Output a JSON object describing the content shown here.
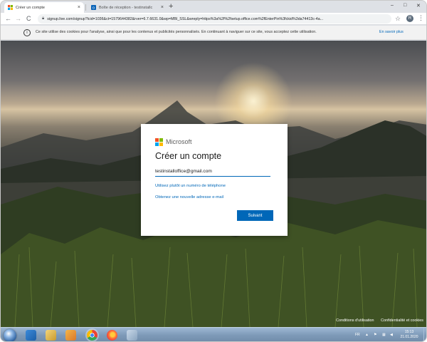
{
  "browser": {
    "tabs": [
      {
        "label": "Créer un compte",
        "active": true
      },
      {
        "label": "Boîte de réception - testinstallc",
        "active": false
      }
    ],
    "new_tab": "+",
    "nav": {
      "back": "←",
      "forward": "→",
      "reload": "C"
    },
    "url": "signup.live.com/signup?lcid=1036&ct=1579644382&rver=6.7.6631.0&wp=MBI_SSL&wreply=https%3a%2f%2fsetup.office.com%2fEnterPin%3fckid%3da74413c-4a...",
    "profile_initial": "R",
    "window_controls": {
      "minimize": "–",
      "maximize": "□",
      "close": "✕"
    }
  },
  "cookie_banner": {
    "info_glyph": "i",
    "text": "Ce site utilise des cookies pour l'analyse, ainsi que pour les contenus et publicités personnalisés. En continuant à naviguer sur ce site, vous acceptez cette utilisation.",
    "link": "En savoir plus"
  },
  "dialog": {
    "brand": "Microsoft",
    "title": "Créer un compte",
    "email_value": "testinstalloffice@gmail.com",
    "link_phone": "Utilisez plutôt un numéro de téléphone",
    "link_new_email": "Obtenez une nouvelle adresse e-mail",
    "next_button": "Suivant"
  },
  "footer": {
    "terms": "Conditions d'utilisation",
    "privacy": "Confidentialité et cookies"
  },
  "taskbar": {
    "language": "FR",
    "time": "15:13",
    "date": "21.01.2020",
    "pinned": [
      "windows-explorer",
      "internet-explorer",
      "file-explorer",
      "media-player",
      "chrome",
      "firefox",
      "paint"
    ]
  },
  "colors": {
    "ms_red": "#f25022",
    "ms_green": "#7fba00",
    "ms_blue": "#00a4ef",
    "ms_yellow": "#ffb900",
    "accent_blue": "#0067b8"
  }
}
